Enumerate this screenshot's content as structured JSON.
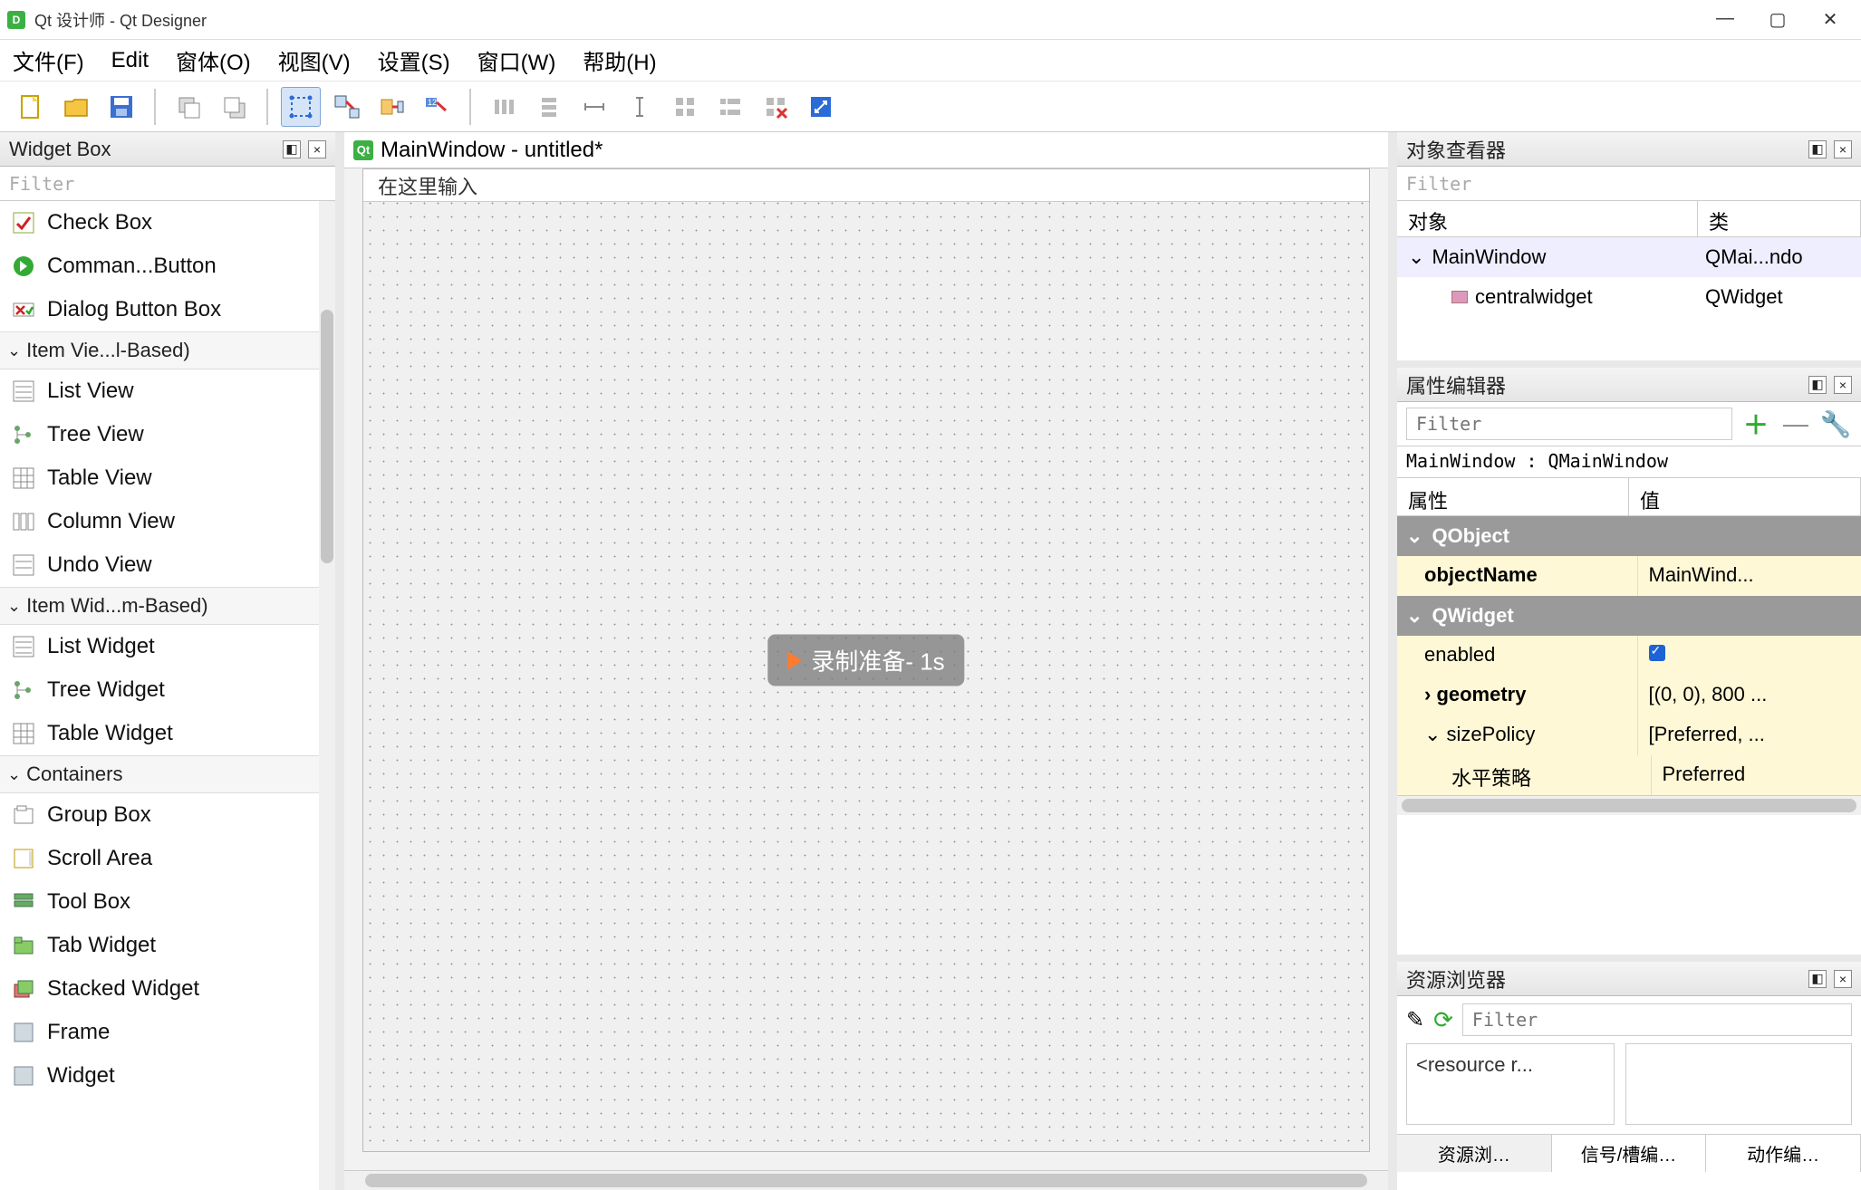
{
  "titlebar": {
    "title": "Qt 设计师 - Qt Designer"
  },
  "menubar": {
    "items": [
      "文件(F)",
      "Edit",
      "窗体(O)",
      "视图(V)",
      "设置(S)",
      "窗口(W)",
      "帮助(H)"
    ]
  },
  "widgetbox": {
    "title": "Widget Box",
    "filter_placeholder": "Filter",
    "pre_items": [
      {
        "label": "Check Box",
        "icon": "checkbox"
      },
      {
        "label": "Comman...Button",
        "icon": "commandlink"
      },
      {
        "label": "Dialog Button Box",
        "icon": "dialogbb"
      }
    ],
    "cat1": "Item Vie...l-Based)",
    "cat1_items": [
      {
        "label": "List View",
        "icon": "list"
      },
      {
        "label": "Tree View",
        "icon": "tree"
      },
      {
        "label": "Table View",
        "icon": "table"
      },
      {
        "label": "Column View",
        "icon": "column"
      },
      {
        "label": "Undo View",
        "icon": "undo"
      }
    ],
    "cat2": "Item Wid...m-Based)",
    "cat2_items": [
      {
        "label": "List Widget",
        "icon": "list"
      },
      {
        "label": "Tree Widget",
        "icon": "tree"
      },
      {
        "label": "Table Widget",
        "icon": "table"
      }
    ],
    "cat3": "Containers",
    "cat3_items": [
      {
        "label": "Group Box",
        "icon": "group"
      },
      {
        "label": "Scroll Area",
        "icon": "scroll"
      },
      {
        "label": "Tool Box",
        "icon": "toolbox"
      },
      {
        "label": "Tab Widget",
        "icon": "tab"
      },
      {
        "label": "Stacked Widget",
        "icon": "stack"
      },
      {
        "label": "Frame",
        "icon": "frame"
      },
      {
        "label": "Widget",
        "icon": "widget"
      }
    ]
  },
  "canvas": {
    "form_title": "MainWindow - untitled*",
    "menubar_hint": "在这里输入",
    "toast": "录制准备- 1s"
  },
  "obj_inspector": {
    "title": "对象查看器",
    "filter_placeholder": "Filter",
    "col1": "对象",
    "col2": "类",
    "rows": [
      {
        "name": "MainWindow",
        "cls": "QMai...ndo",
        "indent": 0,
        "exp": "v"
      },
      {
        "name": "centralwidget",
        "cls": "QWidget",
        "indent": 1,
        "exp": ""
      }
    ]
  },
  "prop_editor": {
    "title": "属性编辑器",
    "filter_placeholder": "Filter",
    "status": "MainWindow : QMainWindow",
    "col1": "属性",
    "col2": "值",
    "groups": [
      {
        "name": "QObject",
        "rows": [
          {
            "k": "objectName",
            "v": "MainWind...",
            "bold": true
          }
        ]
      },
      {
        "name": "QWidget",
        "rows": [
          {
            "k": "enabled",
            "v": "__check__"
          },
          {
            "k": "geometry",
            "v": "[(0, 0), 800 ...",
            "bold": true,
            "exp": ">"
          },
          {
            "k": "sizePolicy",
            "v": "[Preferred, ...",
            "exp": "v"
          },
          {
            "k": "水平策略",
            "v": "Preferred",
            "indent": true
          }
        ]
      }
    ]
  },
  "res_browser": {
    "title": "资源浏览器",
    "filter_placeholder": "Filter",
    "tree_root": "<resource r...",
    "tabs": [
      "资源浏…",
      "信号/槽编…",
      "动作编…"
    ]
  }
}
